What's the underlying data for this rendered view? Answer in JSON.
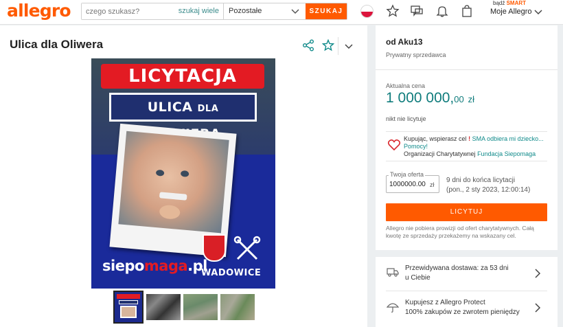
{
  "header": {
    "logo": "allegro",
    "search_placeholder": "czego szukasz?",
    "search_many": "szukaj wiele",
    "category": "Pozostałe",
    "search_button": "SZUKAJ",
    "smart_prefix": "bądź",
    "smart_label": "SMART",
    "account_label": "Moje Allegro",
    "icons": [
      "flag-pl-icon",
      "star-icon",
      "chat-icon",
      "bell-icon",
      "bag-icon",
      "chevron-down-icon"
    ]
  },
  "product": {
    "title": "Ulica dla Oliwera",
    "poster": {
      "headline": "LICYTACJA",
      "street_a": "ULICA",
      "street_b": "DLA",
      "street_c": "OLIWIERA",
      "brand_a": "siepo",
      "brand_b": "maga",
      "brand_c": ".pl",
      "town": "WADOWICE"
    },
    "thumbnails_count": 4
  },
  "seller": {
    "name": "od Aku13",
    "type": "Prywatny sprzedawca"
  },
  "auction": {
    "price_label": "Aktualna cena",
    "price_main": "1 000 000,",
    "price_dec": "00",
    "price_currency": "zł",
    "bids_status": "nikt nie licytuje",
    "charity_intro": "Kupując, wspierasz cel",
    "charity_cause": "SMA odbiera mi dziecko...",
    "charity_more": "Pomocy!",
    "charity_org_prefix": "Organizacji Charytatywnej",
    "charity_org": "Fundacja Siepomaga",
    "offer_label": "Twoja oferta",
    "offer_value": "1000000.00",
    "offer_currency": "zł",
    "days_left": "9 dni do końca licytacji",
    "end_date": "(pon., 2 sty 2023, 12:00:14)",
    "bid_button": "LICYTUJ",
    "note": "Allegro nie pobiera prowizji od ofert charytatywnych. Całą kwotę ze sprzedaży przekażemy na wskazany cel."
  },
  "info_rows": [
    {
      "line1": "Przewidywana dostawa: za 53 dni",
      "line2": "u Ciebie",
      "icon": "truck-icon"
    },
    {
      "line1": "Kupujesz z Allegro Protect",
      "line2": "100% zakupów ze zwrotem pieniędzy",
      "icon": "umbrella-icon"
    }
  ],
  "colors": {
    "brand": "#ff5a00",
    "teal": "#0f7c7c",
    "background": "#eceff1"
  }
}
